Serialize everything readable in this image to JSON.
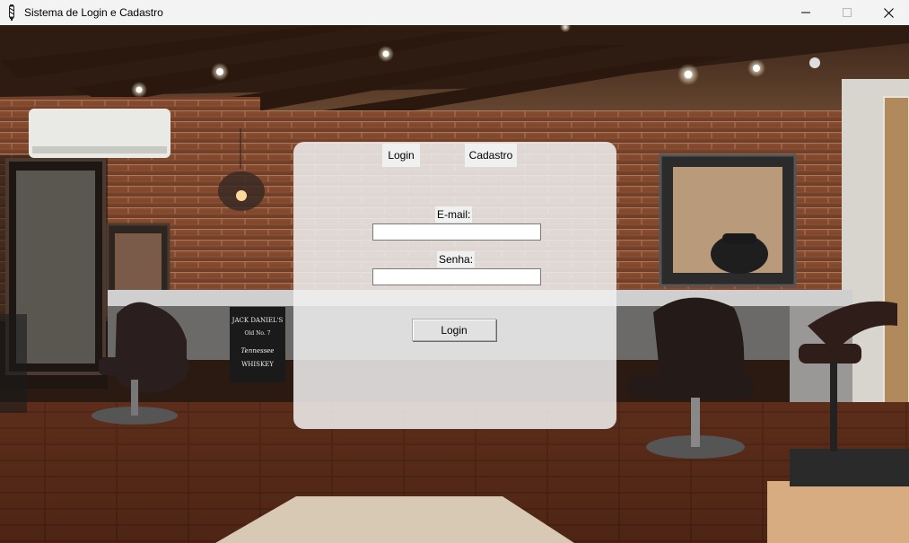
{
  "window": {
    "title": "Sistema de Login e Cadastro",
    "app_icon": "barber-pole-icon",
    "controls": [
      "minimize-icon",
      "maximize-icon",
      "close-icon"
    ]
  },
  "tabs": {
    "login_label": "Login",
    "cadastro_label": "Cadastro"
  },
  "form": {
    "email_label": "E-mail:",
    "email_value": "",
    "password_label": "Senha:",
    "password_value": "",
    "submit_label": "Login"
  },
  "background": {
    "description_icon": "barbershop-photo",
    "signage": {
      "whiskey_line1": "JACK DANIEL'S",
      "whiskey_line2": "Old No. 7",
      "whiskey_line3": "Tennessee",
      "whiskey_line4": "WHISKEY"
    }
  },
  "colors": {
    "panel": "#f0f0f0",
    "titlebar": "#f3f3f3",
    "button": "#e1e1e1"
  }
}
